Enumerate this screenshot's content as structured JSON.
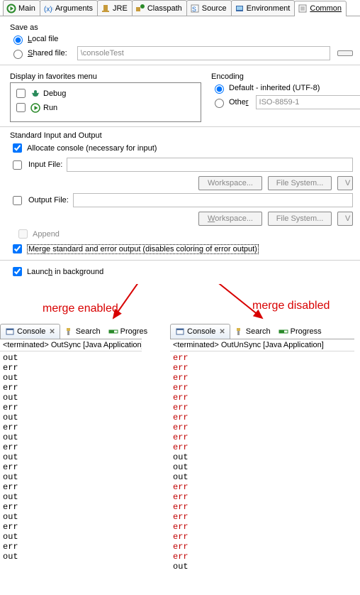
{
  "tabs": {
    "main": "Main",
    "arguments": "Arguments",
    "jre": "JRE",
    "classpath": "Classpath",
    "source": "Source",
    "environment": "Environment",
    "common": "Common"
  },
  "saveAs": {
    "heading": "Save as",
    "localFile": "Local file",
    "sharedFile": "Shared file:",
    "sharedValue": "\\consoleTest"
  },
  "favorites": {
    "heading": "Display in favorites menu",
    "debug": "Debug",
    "run": "Run"
  },
  "encoding": {
    "heading": "Encoding",
    "default": "Default - inherited (UTF-8)",
    "other": "Other",
    "otherValue": "ISO-8859-1"
  },
  "io": {
    "heading": "Standard Input and Output",
    "allocate": "Allocate console (necessary for input)",
    "inputFile": "Input File:",
    "outputFile": "Output File:",
    "workspace": "Workspace...",
    "fileSystem": "File System...",
    "variables": "Variables...",
    "append": "Append",
    "merge": "Merge standard and error output (disables coloring of error output)"
  },
  "launchBg": "Launch in background",
  "annot": {
    "enabled": "merge enabled",
    "disabled": "merge disabled"
  },
  "views": {
    "console": "Console",
    "search": "Search",
    "progress": "Progress",
    "progressShort": "Progres"
  },
  "term": {
    "left": "<terminated> OutSync [Java Application]",
    "right": "<terminated> OutUnSync [Java Application]"
  },
  "leftLines": [
    "out",
    "err",
    "out",
    "err",
    "out",
    "err",
    "out",
    "err",
    "out",
    "err",
    "out",
    "err",
    "out",
    "err",
    "out",
    "err",
    "out",
    "err",
    "out",
    "err",
    "out"
  ],
  "rightLines": [
    {
      "t": "err",
      "c": "err"
    },
    {
      "t": "err",
      "c": "err"
    },
    {
      "t": "err",
      "c": "err"
    },
    {
      "t": "err",
      "c": "err"
    },
    {
      "t": "err",
      "c": "err"
    },
    {
      "t": "err",
      "c": "err"
    },
    {
      "t": "err",
      "c": "err"
    },
    {
      "t": "err",
      "c": "err"
    },
    {
      "t": "err",
      "c": "err"
    },
    {
      "t": "err",
      "c": "err"
    },
    {
      "t": "out",
      "c": "out"
    },
    {
      "t": "out",
      "c": "out"
    },
    {
      "t": "out",
      "c": "out"
    },
    {
      "t": "err",
      "c": "err"
    },
    {
      "t": "err",
      "c": "err"
    },
    {
      "t": "err",
      "c": "err"
    },
    {
      "t": "err",
      "c": "err"
    },
    {
      "t": "err",
      "c": "err"
    },
    {
      "t": "err",
      "c": "err"
    },
    {
      "t": "err",
      "c": "err"
    },
    {
      "t": "err",
      "c": "err"
    },
    {
      "t": "out",
      "c": "out"
    }
  ]
}
